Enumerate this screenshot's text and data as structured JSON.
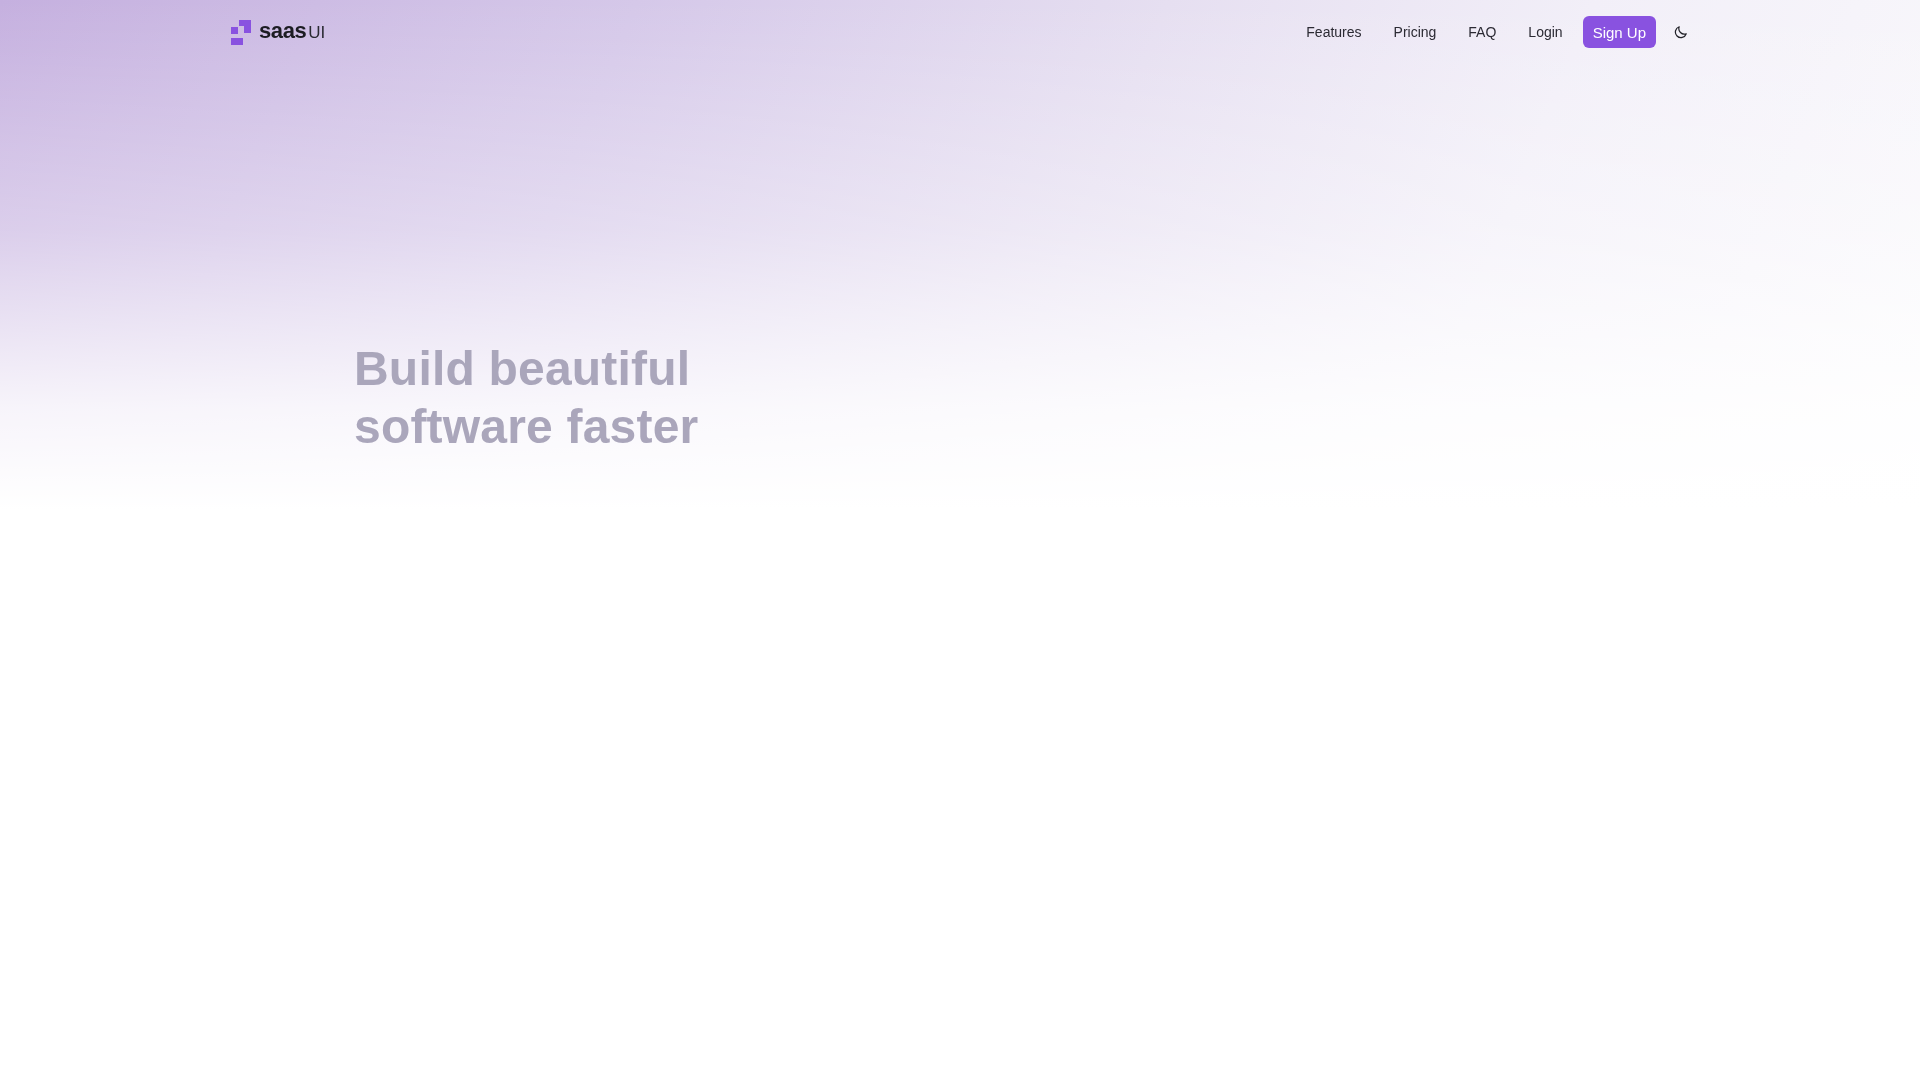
{
  "header": {
    "logo": {
      "text": "**saas**UI"
    },
    "nav_links": [
      {
        "label": "Features"
      },
      {
        "label": "Pricing"
      },
      {
        "label": "FAQ"
      },
      {
        "label": "Login"
      }
    ],
    "signup_button": "Sign Up"
  },
  "hero": {
    "title": "Build beautiful software faster"
  }
}
